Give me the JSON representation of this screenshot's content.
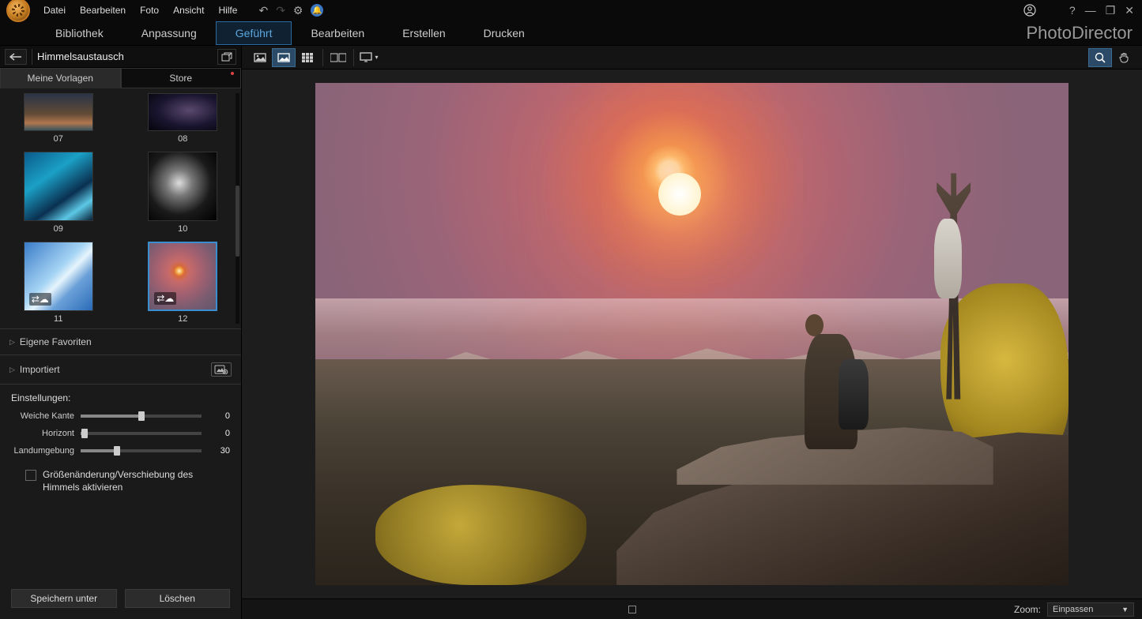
{
  "menu": {
    "items": [
      "Datei",
      "Bearbeiten",
      "Foto",
      "Ansicht",
      "Hilfe"
    ]
  },
  "nav": {
    "items": [
      "Bibliothek",
      "Anpassung",
      "Geführt",
      "Bearbeiten",
      "Erstellen",
      "Drucken"
    ],
    "active_index": 2
  },
  "brand": "PhotoDirector",
  "breadcrumb": {
    "label": "Himmelsaustausch"
  },
  "sidebar_tabs": {
    "templates": "Meine Vorlagen",
    "store": "Store",
    "active": "templates"
  },
  "thumbs": [
    {
      "id": "07",
      "label": "07"
    },
    {
      "id": "08",
      "label": "08"
    },
    {
      "id": "09",
      "label": "09"
    },
    {
      "id": "10",
      "label": "10"
    },
    {
      "id": "11",
      "label": "11",
      "cloud": true
    },
    {
      "id": "12",
      "label": "12",
      "cloud": true,
      "selected": true
    }
  ],
  "accordion": {
    "favorites": "Eigene Favoriten",
    "imported": "Importiert"
  },
  "settings": {
    "title": "Einstellungen:",
    "sliders": [
      {
        "label": "Weiche Kante",
        "value": 0,
        "pos": 50
      },
      {
        "label": "Horizont",
        "value": 0,
        "pos": 3
      },
      {
        "label": "Landumgebung",
        "value": 30,
        "pos": 30
      }
    ],
    "checkbox_label": "Größenänderung/Verschiebung des Himmels aktivieren",
    "checkbox_checked": false
  },
  "buttons": {
    "save": "Speichern unter",
    "delete": "Löschen"
  },
  "status": {
    "zoom_label": "Zoom:",
    "zoom_value": "Einpassen"
  }
}
